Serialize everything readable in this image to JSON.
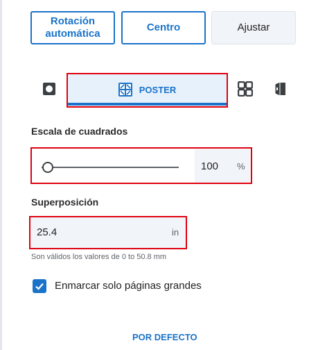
{
  "buttons": {
    "auto_rotate": "Rotación automática",
    "center": "Centro",
    "fit": "Ajustar"
  },
  "tabs": {
    "poster_label": "POSTER",
    "icons": [
      "single-page-icon",
      "poster-icon",
      "grid-icon",
      "booklet-icon"
    ]
  },
  "scale": {
    "label": "Escala de cuadrados",
    "value": "100",
    "unit": "%",
    "slider_fraction": 0.0
  },
  "overlap": {
    "label": "Superposición",
    "value": "25.4",
    "unit": "in",
    "hint": "Son válidos los valores de 0 to 50.8 mm"
  },
  "frame_large_pages": {
    "label": "Enmarcar solo páginas grandes",
    "checked": true
  },
  "default_button": "POR DEFECTO",
  "colors": {
    "accent": "#1a73c9",
    "highlight_box": "#e0000e",
    "field_bg": "#f1f4f8"
  }
}
